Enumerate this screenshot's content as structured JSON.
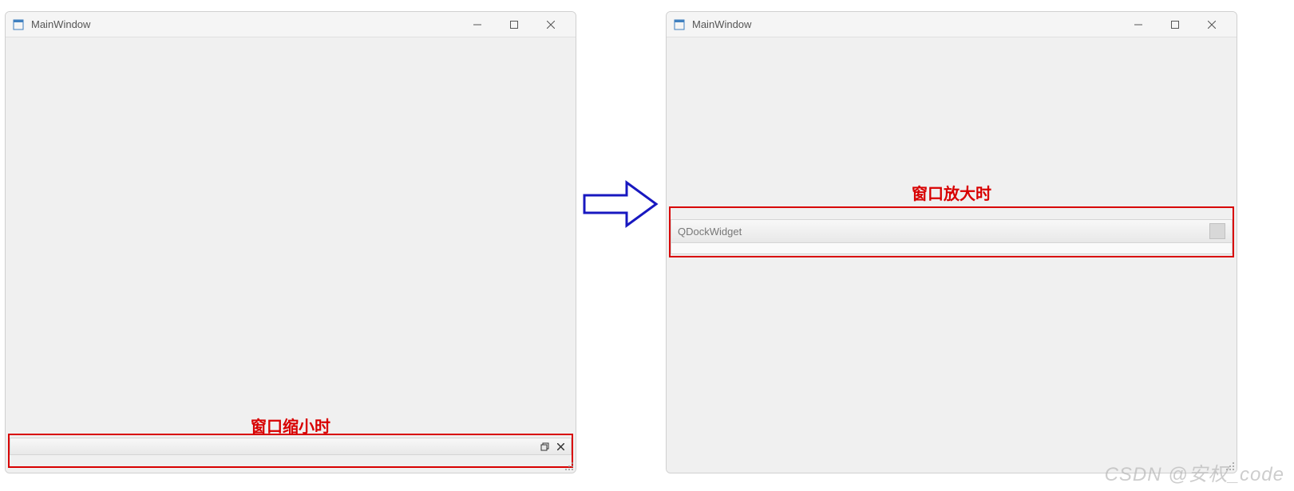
{
  "leftWindow": {
    "title": "MainWindow",
    "annotation": "窗口缩小时"
  },
  "rightWindow": {
    "title": "MainWindow",
    "annotation": "窗口放大时",
    "dockTitle": "QDockWidget"
  },
  "watermark": "CSDN @安权_code"
}
